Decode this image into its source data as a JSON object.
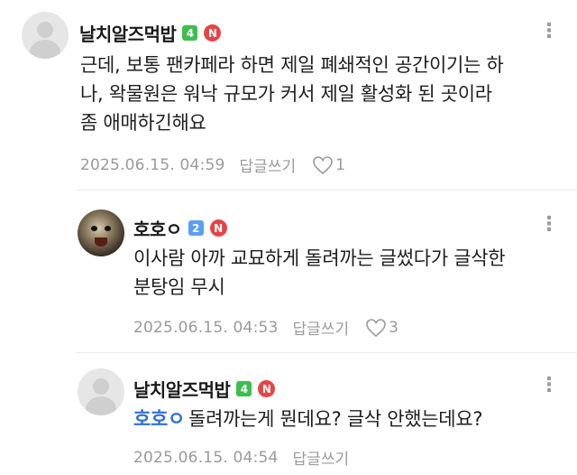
{
  "comments": [
    {
      "nickname": "날치알즈먹밥",
      "level": "4",
      "badge": "N",
      "more": "⋮",
      "lines": [
        "근데, 보통 팬카페라 하면 제일 폐쇄적인 공간이기는 하",
        "나, 왁물원은 워낙 규모가 커서 제일 활성화 된 곳이라",
        "좀 애매하긴해요"
      ],
      "date": "2025.06.15. 04:59",
      "reply_label": "답글쓰기",
      "likes": "1"
    },
    {
      "nickname": "호호ㅇ",
      "level": "2",
      "badge": "N",
      "more": "⋮",
      "lines": [
        "이사람 아까 교묘하게 돌려까는 글썼다가 글삭한",
        "분탕임 무시"
      ],
      "date": "2025.06.15. 04:53",
      "reply_label": "답글쓰기",
      "likes": "3"
    },
    {
      "nickname": "날치알즈먹밥",
      "level": "4",
      "badge": "N",
      "more": "⋮",
      "mention": "호호ㅇ",
      "lines": [
        "돌려까는게 뭔데요? 글삭 안했는데요?"
      ],
      "date": "2025.06.15. 04:54",
      "reply_label": "답글쓰기",
      "likes": ""
    }
  ],
  "colors": {
    "mention": "#2f6fd6",
    "level_green": "#3cbf4e",
    "level_blue": "#5aa0f0",
    "badge_red": "#e84343",
    "meta_gray": "#9a9a9a"
  },
  "icons": [
    "default-avatar-icon",
    "profile-photo-avatar",
    "level-badge-icon",
    "new-badge-icon",
    "more-options-icon",
    "heart-icon"
  ]
}
